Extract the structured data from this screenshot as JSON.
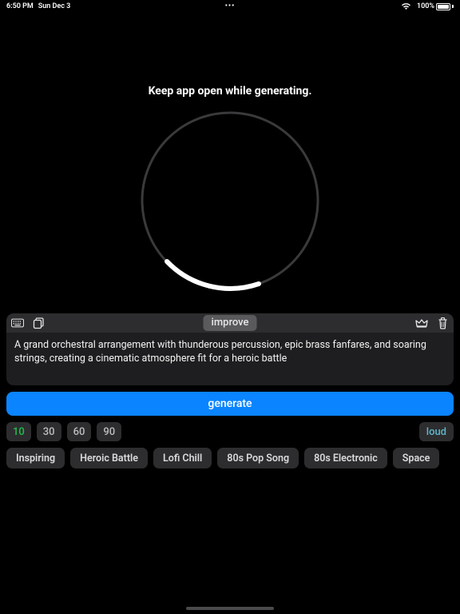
{
  "status": {
    "time": "6:50 PM",
    "date": "Sun Dec 3",
    "dots": "•••",
    "battery": "100%"
  },
  "message": "Keep app open while generating.",
  "toolbar": {
    "improve": "improve"
  },
  "prompt_text": "A grand orchestral arrangement with thunderous percussion, epic brass fanfares, and soaring strings, creating a cinematic atmosphere fit for a heroic battle",
  "generate_label": "generate",
  "durations": {
    "opts": [
      "10",
      "30",
      "60",
      "90"
    ],
    "active": "10"
  },
  "loud_label": "loud",
  "presets": [
    "Inspiring",
    "Heroic Battle",
    "Lofi Chill",
    "80s Pop Song",
    "80s Electronic",
    "Space"
  ]
}
